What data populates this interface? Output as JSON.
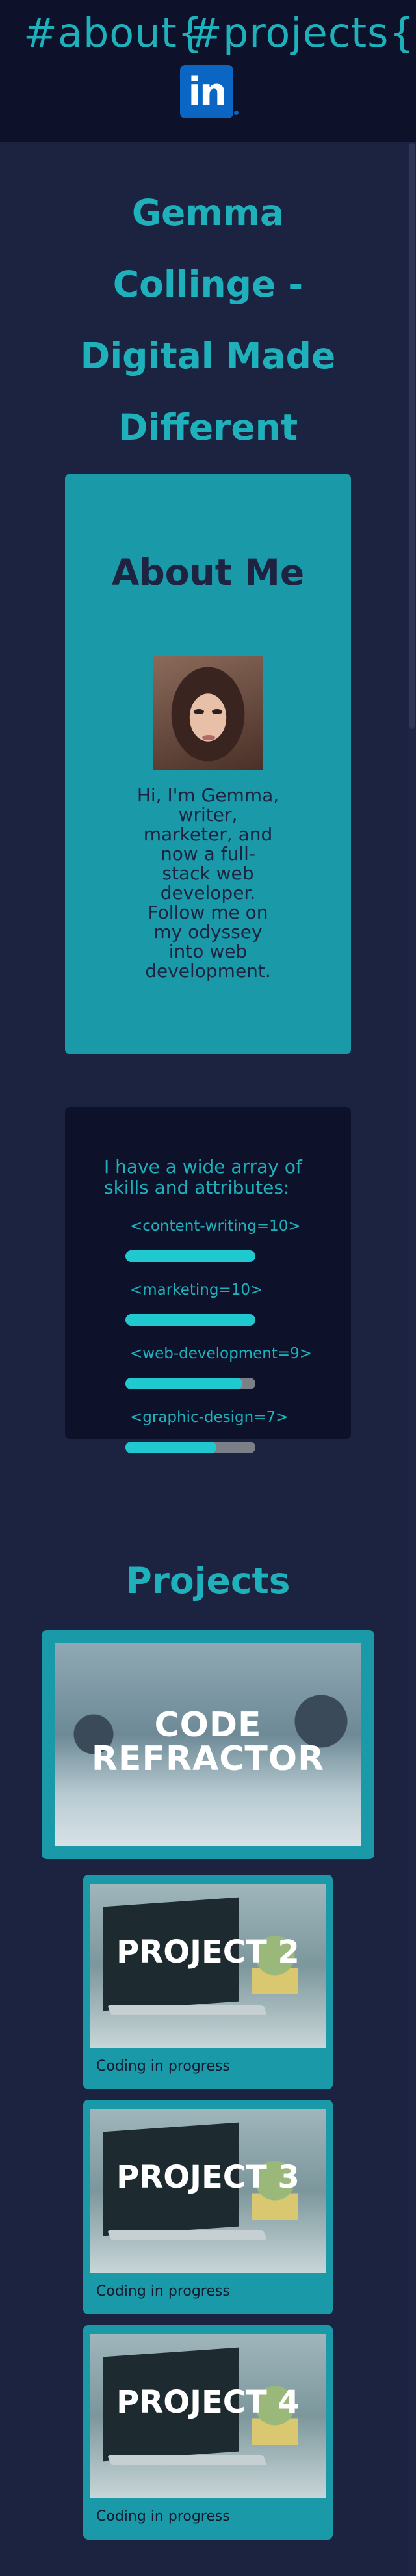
{
  "nav": {
    "about": "#about{",
    "projects": "#projects{",
    "linkedin_icon": "linkedin-icon",
    "linkedin_text": "in"
  },
  "hero": {
    "title": "Gemma Collinge - Digital Made Different"
  },
  "about": {
    "title": "About Me",
    "text": "Hi, I'm Gemma, writer, marketer, and now a full-stack web developer. Follow me on my odyssey into web development."
  },
  "skills": {
    "intro": "I have a wide array of skills and attributes:",
    "items": [
      {
        "label": "<content-writing=10>",
        "level": 10
      },
      {
        "label": "<marketing=10>",
        "level": 10
      },
      {
        "label": "<web-development=9>",
        "level": 9
      },
      {
        "label": "<graphic-design=7>",
        "level": 7
      }
    ]
  },
  "projects": {
    "title": "Projects",
    "main": {
      "title": "CODE REFRACTOR"
    },
    "items": [
      {
        "title": "PROJECT 2",
        "caption": "Coding in progress"
      },
      {
        "title": "PROJECT 3",
        "caption": "Coding in progress"
      },
      {
        "title": "PROJECT 4",
        "caption": "Coding in progress"
      }
    ]
  },
  "colors": {
    "background": "#1c2340",
    "header": "#0d1129",
    "accent": "#1fb1bb",
    "card": "#1a9aa8",
    "skill_fill": "#1fc9cf"
  }
}
